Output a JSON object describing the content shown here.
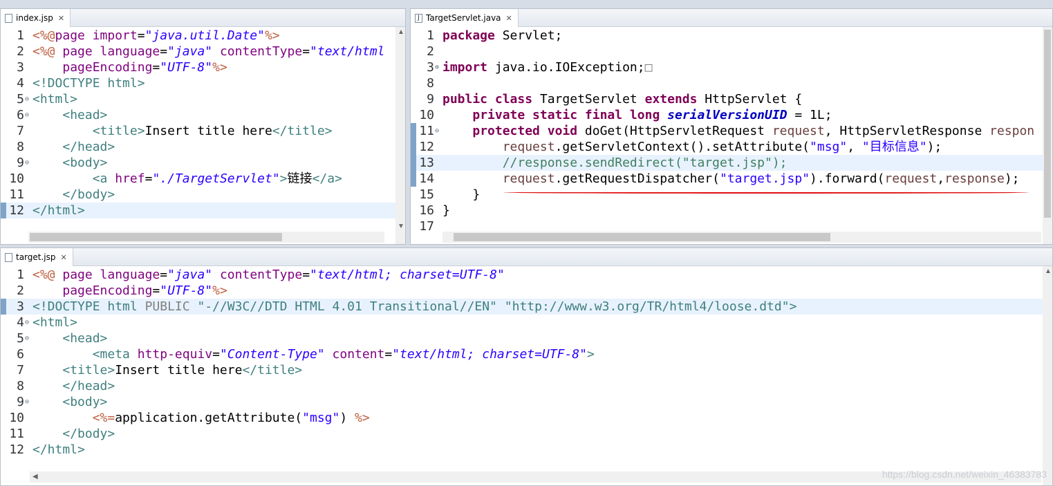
{
  "editors": {
    "index": {
      "tab_label": "index.jsp",
      "lines": [
        {
          "n": "1",
          "html": "<span class='d'>&lt;%@</span><span class='a'>page import</span>=<span class='s'>\"java.util.Date\"</span><span class='d'>%&gt;</span>"
        },
        {
          "n": "2",
          "html": "<span class='d'>&lt;%@</span> <span class='a'>page language</span>=<span class='s'>\"java\"</span> <span class='a'>contentType</span>=<span class='s'>\"text/html</span>"
        },
        {
          "n": "3",
          "html": "    <span class='a'>pageEncoding</span>=<span class='s'>\"UTF-8\"</span><span class='d'>%&gt;</span>"
        },
        {
          "n": "4",
          "html": "<span class='t'>&lt;!DOCTYPE html&gt;</span>"
        },
        {
          "n": "5",
          "html": "<span class='t'>&lt;html&gt;</span>"
        },
        {
          "n": "6",
          "html": "    <span class='t'>&lt;head&gt;</span>"
        },
        {
          "n": "7",
          "html": "        <span class='t'>&lt;title&gt;</span>Insert title here<span class='t'>&lt;/title&gt;</span>"
        },
        {
          "n": "8",
          "html": "    <span class='t'>&lt;/head&gt;</span>"
        },
        {
          "n": "9",
          "html": "    <span class='t'>&lt;body&gt;</span>"
        },
        {
          "n": "10",
          "html": "        <span class='t'>&lt;a</span> <span class='a'>href</span>=<span class='s'>\"./TargetServlet\"</span><span class='t'>&gt;</span>链接<span class='t'>&lt;/a&gt;</span>"
        },
        {
          "n": "11",
          "html": "    <span class='t'>&lt;/body&gt;</span>"
        },
        {
          "n": "12",
          "html": "<span class='t'>&lt;/html&gt;</span>"
        }
      ]
    },
    "servlet": {
      "tab_label": "TargetServlet.java",
      "lines": [
        {
          "n": "1",
          "html": "<span class='k'>package</span> Servlet;"
        },
        {
          "n": "2",
          "html": ""
        },
        {
          "n": "3",
          "html": "<span class='k'>import</span> java.io.IOException;<span class='p'>&#9633;</span>"
        },
        {
          "n": "8",
          "html": ""
        },
        {
          "n": "9",
          "html": "<span class='k'>public class</span> TargetServlet <span class='k'>extends</span> HttpServlet {"
        },
        {
          "n": "10",
          "html": "    <span class='k'>private static final long</span> <span class='f'>serialVersionUID</span> = 1L;"
        },
        {
          "n": "11",
          "html": "    <span class='k'>protected void</span> doGet(HttpServletRequest <span class='pm'>request</span>, HttpServletResponse <span class='pm'>respon</span>"
        },
        {
          "n": "12",
          "html": "        <span class='pm'>request</span>.getServletContext().setAttribute(<span class='s2'>\"msg\"</span>, <span class='s2'>\"目标信息\"</span>);"
        },
        {
          "n": "13",
          "html": "        <span class='c'>//response.sendRedirect(\"target.jsp\");</span>"
        },
        {
          "n": "14",
          "html": "        <span class='pm'>request</span>.getRequestDispatcher(<span class='s2'>\"target.jsp\"</span>).forward(<span class='pm'>request</span>,<span class='pm'>response</span>);"
        },
        {
          "n": "15",
          "html": "    }"
        },
        {
          "n": "16",
          "html": "}"
        },
        {
          "n": "17",
          "html": ""
        }
      ]
    },
    "target": {
      "tab_label": "target.jsp",
      "lines": [
        {
          "n": "1",
          "html": "<span class='d'>&lt;%@</span> <span class='a'>page language</span>=<span class='s'>\"java\"</span> <span class='a'>contentType</span>=<span class='s'>\"text/html; charset=UTF-8\"</span>"
        },
        {
          "n": "2",
          "html": "    <span class='a'>pageEncoding</span>=<span class='s'>\"UTF-8\"</span><span class='d'>%&gt;</span>"
        },
        {
          "n": "3",
          "html": "<span class='t'>&lt;!DOCTYPE html</span> <span class='p'>PUBLIC</span> <span class='t'>\"-//W3C//DTD HTML 4.01 Transitional//EN\"</span> <span class='t'>\"http://www.w3.org/TR/html4/loose.dtd\"&gt;</span>"
        },
        {
          "n": "4",
          "html": "<span class='t'>&lt;html&gt;</span>"
        },
        {
          "n": "5",
          "html": "    <span class='t'>&lt;head&gt;</span>"
        },
        {
          "n": "6",
          "html": "        <span class='t'>&lt;meta</span> <span class='a'>http-equiv</span>=<span class='s'>\"Content-Type\"</span> <span class='a'>content</span>=<span class='s'>\"text/html; charset=UTF-8\"</span><span class='t'>&gt;</span>"
        },
        {
          "n": "7",
          "html": "    <span class='t'>&lt;title&gt;</span>Insert title here<span class='t'>&lt;/title&gt;</span>"
        },
        {
          "n": "8",
          "html": "    <span class='t'>&lt;/head&gt;</span>"
        },
        {
          "n": "9",
          "html": "    <span class='t'>&lt;body&gt;</span>"
        },
        {
          "n": "10",
          "html": "        <span class='d'>&lt;%=</span>application.getAttribute(<span class='s2'>\"msg\"</span>) <span class='d'>%&gt;</span>"
        },
        {
          "n": "11",
          "html": "    <span class='t'>&lt;/body&gt;</span>"
        },
        {
          "n": "12",
          "html": "<span class='t'>&lt;/html&gt;</span>"
        }
      ]
    }
  },
  "watermark": "https://blog.csdn.net/weixin_46383783",
  "colors": {
    "highlight_line": "#e8f2fe",
    "annotation_underline": "#e01010"
  }
}
